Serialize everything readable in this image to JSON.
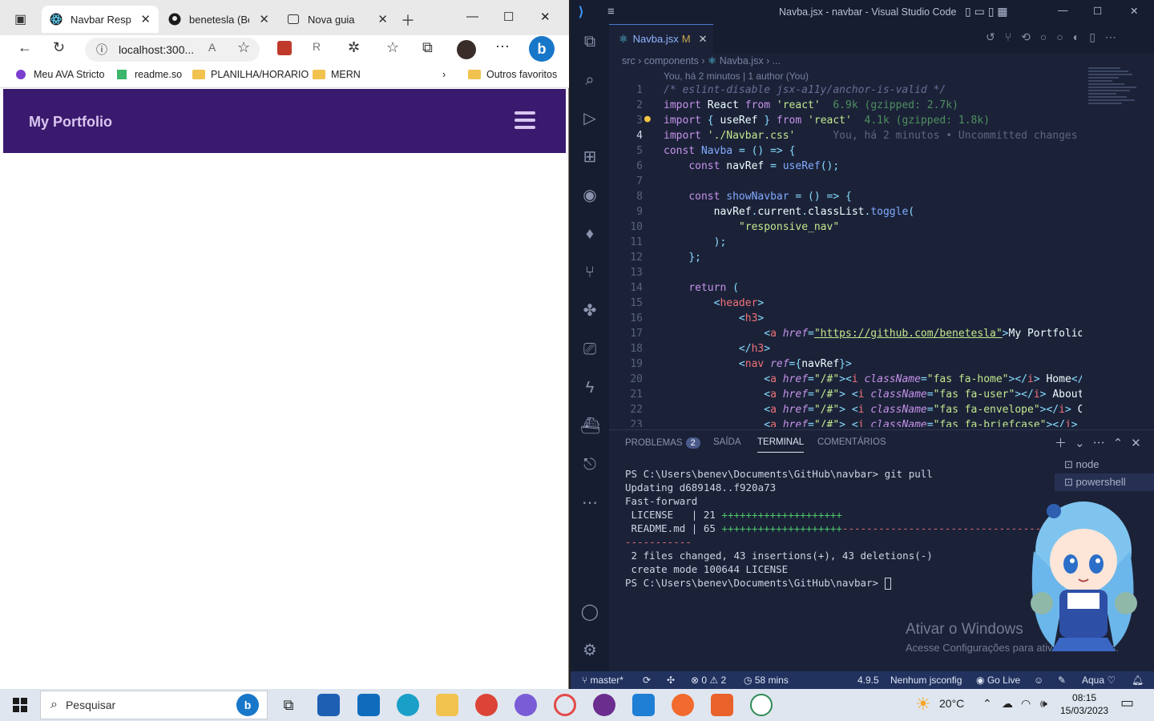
{
  "browser": {
    "tabs": [
      {
        "title": "Navbar Respon",
        "active": true
      },
      {
        "title": "benetesla (Bene",
        "active": false
      },
      {
        "title": "Nova guia",
        "active": false
      }
    ],
    "address": "localhost:300...",
    "favorites": [
      "Meu AVA Stricto",
      "readme.so",
      "PLANILHA/HORARIO",
      "MERN",
      "Outros favoritos"
    ],
    "page": {
      "site_title": "My Portfolio"
    }
  },
  "vscode": {
    "window_title": "Navba.jsx - navbar - Visual Studio Code",
    "tab": {
      "name": "Navba.jsx",
      "status": "M"
    },
    "breadcrumb": [
      "src",
      "components",
      "Navba.jsx",
      "..."
    ],
    "blame_header": "You, há 2 minutos | 1 author (You)",
    "inline_blame": "You, há 2 minutos • Uncommitted changes",
    "line_numbers": [
      "1",
      "2",
      "3",
      "4",
      "5",
      "6",
      "7",
      "8",
      "9",
      "10",
      "11",
      "12",
      "13",
      "14",
      "15",
      "16",
      "17",
      "18",
      "19",
      "20",
      "21",
      "22",
      "23"
    ],
    "panel_tabs": {
      "problems": "PROBLEMAS",
      "problems_count": "2",
      "output": "SAÍDA",
      "terminal": "TERMINAL",
      "comments": "COMENTÁRIOS"
    },
    "terminal_lines": {
      "l1_prompt": "PS C:\\Users\\benev\\Documents\\GitHub\\navbar>",
      "l1_cmd": " git pull",
      "l2": "Updating d689148..f920a73",
      "l3": "Fast-forward",
      "l4_a": " LICENSE   | 21 ",
      "l4_plus": "++++++++++++++++++++",
      "l5_a": " README.md | 65 ",
      "l5_plus": "++++++++++++++++++++",
      "l5_minus": "------------------------------------",
      "l6_minus": "-----------",
      "l7": " 2 files changed, 43 insertions(+), 43 deletions(-)",
      "l8": " create mode 100644 LICENSE",
      "l9_prompt": "PS C:\\Users\\benev\\Documents\\GitHub\\navbar> "
    },
    "shells": [
      "node",
      "powershell"
    ],
    "watermark": {
      "title": "Ativar o Windows",
      "subtitle": "Acesse Configurações para ativar o Windows."
    },
    "statusbar": {
      "branch": "master*",
      "errors": "0",
      "warnings": "2",
      "time": "58 mins",
      "version": "4.9.5",
      "jsconfig": "Nenhum jsconfig",
      "golive": "Go Live",
      "theme": "Aqua"
    }
  },
  "taskbar": {
    "search_placeholder": "Pesquisar",
    "weather": "20°C",
    "time": "08:15",
    "date": "15/03/2023"
  }
}
